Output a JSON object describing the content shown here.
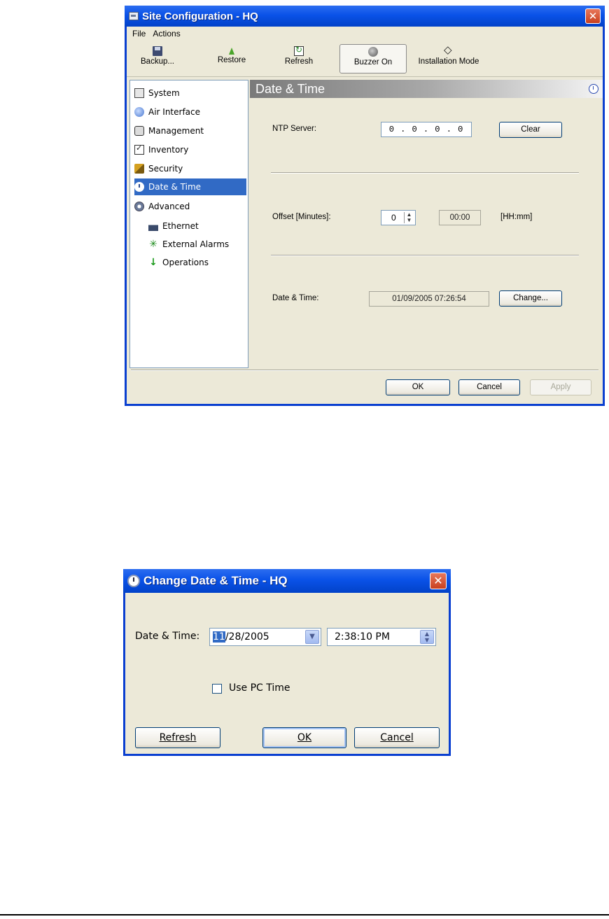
{
  "site_config": {
    "title": "Site Configuration - HQ",
    "menu": [
      "File",
      "Actions"
    ],
    "toolbar": {
      "backup": "Backup...",
      "restore": "Restore",
      "refresh": "Refresh",
      "buzzer": "Buzzer On",
      "install": "Installation Mode"
    },
    "nav": {
      "system": "System",
      "air": "Air Interface",
      "management": "Management",
      "inventory": "Inventory",
      "security": "Security",
      "datetime": "Date & Time",
      "advanced": "Advanced",
      "ethernet": "Ethernet",
      "alarms": "External Alarms",
      "operations": "Operations"
    },
    "section_title": "Date & Time",
    "ntp_label": "NTP Server:",
    "ntp_value": "0 . 0 . 0 . 0",
    "clear_button": "Clear",
    "offset_label": "Offset [Minutes]:",
    "offset_value": "0",
    "offset_time": "00:00",
    "offset_unit": "[HH:mm]",
    "datetime_label": "Date & Time:",
    "datetime_value": "01/09/2005 07:26:54",
    "change_button": "Change...",
    "ok_button": "OK",
    "cancel_button": "Cancel",
    "apply_button": "Apply"
  },
  "change_dialog": {
    "title": "Change Date & Time - HQ",
    "datetime_label": "Date & Time:",
    "date_month": "11",
    "date_rest": "/28/2005",
    "time_value": "2:38:10 PM",
    "use_pc_time": "Use PC Time",
    "refresh_button": "Refresh",
    "ok_button": "OK",
    "cancel_button": "Cancel"
  },
  "icons": {
    "close": "close-icon",
    "clock": "clock-icon"
  },
  "colors": {
    "title_bar": "#0a52e8",
    "selection": "#316ac5",
    "window_bg": "#ece9d8"
  }
}
